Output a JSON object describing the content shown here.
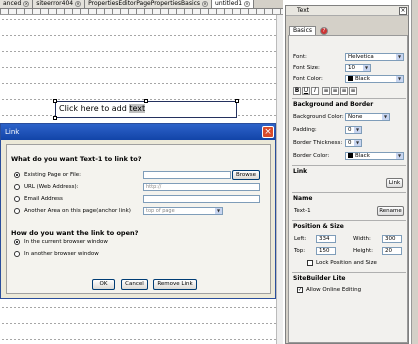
{
  "tabs": [
    "anced",
    "siteerror404",
    "PropertiesEditorPagePropertiesBasics",
    "untitled1"
  ],
  "canvas": {
    "text_element_value": "Click here to add ",
    "text_element_selected": "text"
  },
  "dialog": {
    "title": "Link",
    "q1": "What do you want Text-1 to link to?",
    "options": [
      {
        "label": "Existing Page or File:",
        "field": "",
        "button": "Browse"
      },
      {
        "label": "URL (Web Address):",
        "field": "http://"
      },
      {
        "label": "Email Address",
        "field": ""
      },
      {
        "label": "Another Area on this page(anchor link)",
        "field": "top of page"
      }
    ],
    "q2": "How do you want the link to open?",
    "open_options": [
      "In the current browser window",
      "In another browser window"
    ],
    "buttons": {
      "ok": "OK",
      "cancel": "Cancel",
      "remove": "Remove Link"
    }
  },
  "panel": {
    "title": "Text",
    "tab_basics": "Basics",
    "font_label": "Font:",
    "font_value": "Helvetica",
    "size_label": "Font Size:",
    "size_value": "10",
    "color_label": "Font Color:",
    "color_value": "Black",
    "format_buttons": [
      "B",
      "U",
      "I"
    ],
    "bg_section": "Background and Border",
    "bgcolor_label": "Background Color:",
    "bgcolor_value": "None",
    "padding_label": "Padding:",
    "padding_value": "0",
    "border_thick_label": "Border Thickness:",
    "border_thick_value": "0",
    "border_color_label": "Border Color:",
    "border_color_value": "Black",
    "link_section": "Link",
    "link_button": "Link",
    "name_section": "Name",
    "name_value": "Text-1",
    "rename_button": "Rename",
    "pos_section": "Position & Size",
    "left_label": "Left:",
    "left_value": "334",
    "width_label": "Width:",
    "width_value": "300",
    "top_label": "Top:",
    "top_value": "150",
    "height_label": "Height:",
    "height_value": "20",
    "lock_label": "Lock Position and Size",
    "sbl_section": "SiteBuilder Lite",
    "allow_label": "Allow Online Editing"
  }
}
